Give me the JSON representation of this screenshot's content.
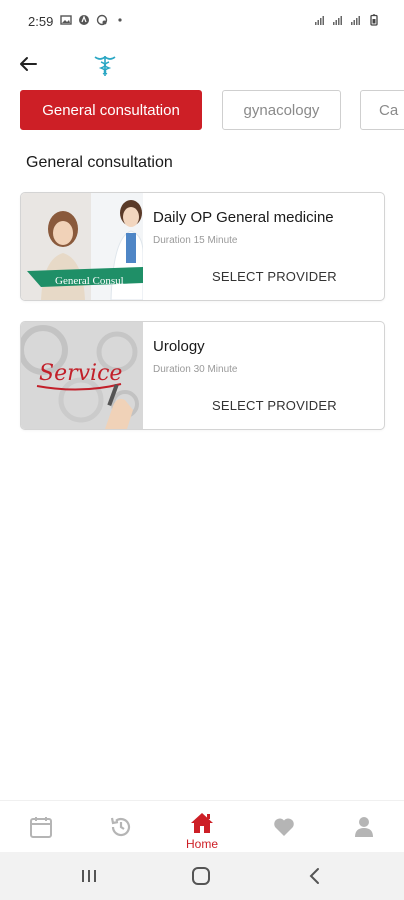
{
  "status_bar": {
    "time": "2:59",
    "icons": [
      "image-icon",
      "app-icon",
      "call-icon",
      "dot-icon",
      "wifi-icon",
      "signal-icon",
      "signal-icon",
      "battery-icon"
    ]
  },
  "header": {
    "back_icon": "arrow-left-icon",
    "logo_icon": "caduceus-logo-icon"
  },
  "tabs": [
    {
      "label": "General consultation",
      "active": true
    },
    {
      "label": "gynacology",
      "active": false
    },
    {
      "label": "Ca",
      "active": false
    }
  ],
  "section_title": "General consultation",
  "services": [
    {
      "title": "Daily OP General medicine",
      "duration": "Duration 15 Minute",
      "action": "SELECT PROVIDER",
      "image_caption": "General Consul"
    },
    {
      "title": "Urology",
      "duration": "Duration 30 Minute",
      "action": "SELECT PROVIDER",
      "image_caption": "Service"
    }
  ],
  "bottom_nav": {
    "items": [
      {
        "icon": "calendar-icon",
        "label": ""
      },
      {
        "icon": "history-icon",
        "label": ""
      },
      {
        "icon": "home-icon",
        "label": "Home",
        "active": true
      },
      {
        "icon": "heart-icon",
        "label": ""
      },
      {
        "icon": "user-icon",
        "label": ""
      }
    ],
    "active_color": "#cd1f26",
    "inactive_color": "#b5b5b5"
  },
  "system_nav": {
    "icons": [
      "recent-apps-icon",
      "home-circle-icon",
      "back-chevron-icon"
    ]
  },
  "colors": {
    "accent": "#cd1f26"
  }
}
